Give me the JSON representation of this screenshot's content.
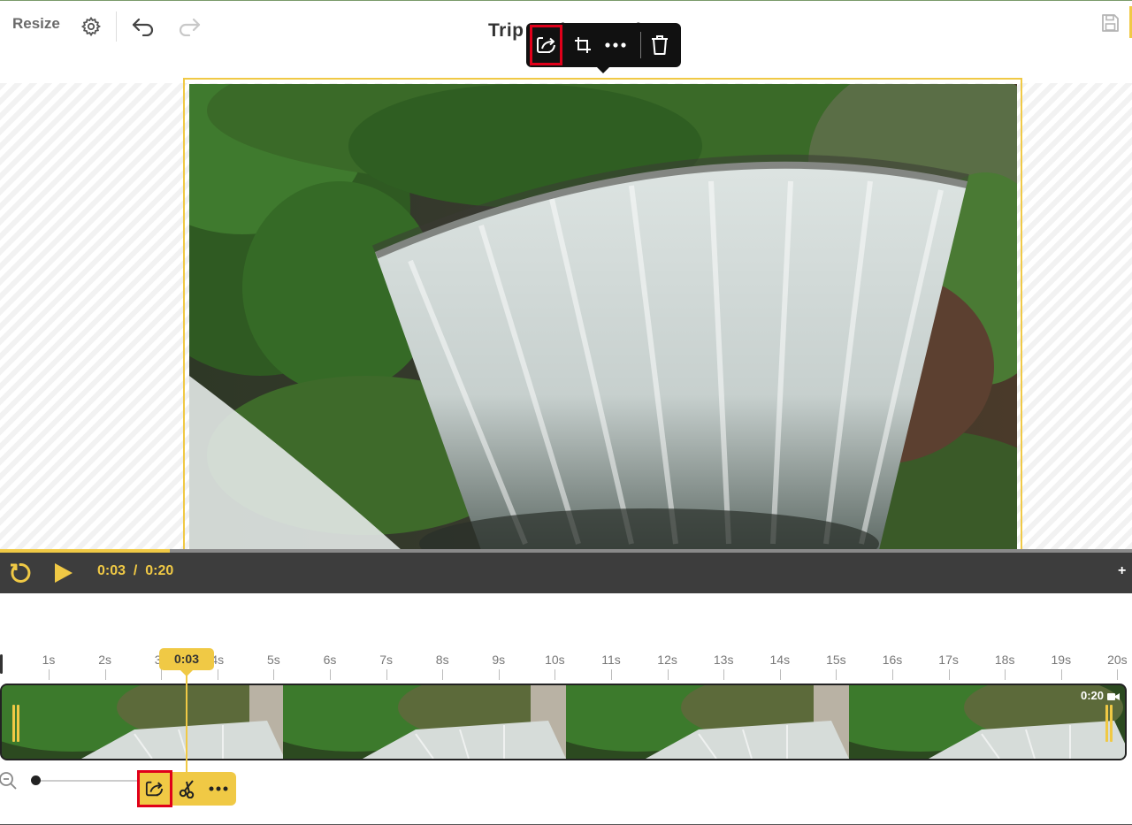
{
  "header": {
    "resize_label": "Resize",
    "title": "Trip to the Woods",
    "icons": [
      "gear-icon",
      "undo-icon",
      "redo-icon",
      "save-icon"
    ]
  },
  "floating_toolbar": {
    "buttons": [
      "replace-icon",
      "crop-icon",
      "more-icon",
      "delete-icon"
    ],
    "highlighted": "replace-icon"
  },
  "player": {
    "current_time": "0:03",
    "separator": "/",
    "duration": "0:20",
    "progress_fraction": 0.15,
    "add_label": "+"
  },
  "timeline": {
    "ticks": [
      "1s",
      "2s",
      "3s",
      "4s",
      "5s",
      "6s",
      "7s",
      "8s",
      "9s",
      "10s",
      "11s",
      "12s",
      "13s",
      "14s",
      "15s",
      "16s",
      "17s",
      "18s",
      "19s",
      "20s"
    ],
    "playhead_label": "0:03",
    "clip_duration": "0:20"
  },
  "clip_toolbar": {
    "buttons": [
      "replace-icon",
      "scissors-icon",
      "more-icon"
    ],
    "highlighted": "replace-icon"
  },
  "colors": {
    "accent": "#f0c945",
    "player_bg": "#3d3d3d",
    "highlight": "#e0001a",
    "toolbar_bg": "#111111"
  }
}
